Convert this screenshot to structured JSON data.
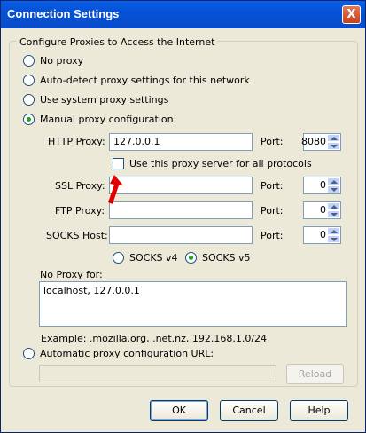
{
  "window": {
    "title": "Connection Settings",
    "close_label": "X"
  },
  "group": {
    "label": "Configure Proxies to Access the Internet"
  },
  "options": {
    "no_proxy": "No proxy",
    "auto_detect": "Auto-detect proxy settings for this network",
    "system": "Use system proxy settings",
    "manual": "Manual proxy configuration:",
    "auto_url": "Automatic proxy configuration URL:"
  },
  "http": {
    "label": "HTTP Proxy:",
    "value": "127.0.0.1",
    "port_label": "Port:",
    "port": "8080"
  },
  "use_all": {
    "label": "Use this proxy server for all protocols",
    "checked": false
  },
  "ssl": {
    "label": "SSL Proxy:",
    "value": "",
    "port_label": "Port:",
    "port": "0"
  },
  "ftp": {
    "label": "FTP Proxy:",
    "value": "",
    "port_label": "Port:",
    "port": "0"
  },
  "socks": {
    "label": "SOCKS Host:",
    "value": "",
    "port_label": "Port:",
    "port": "0",
    "v4": "SOCKS v4",
    "v5": "SOCKS v5"
  },
  "no_proxy_for": {
    "label": "No Proxy for:",
    "value": "localhost, 127.0.0.1",
    "example": "Example: .mozilla.org, .net.nz, 192.168.1.0/24"
  },
  "auto_url": {
    "value": "",
    "reload": "Reload"
  },
  "buttons": {
    "ok": "OK",
    "cancel": "Cancel",
    "help": "Help"
  },
  "colors": {
    "titlebar": "#0a5ee8",
    "annotation_arrow": "#e00000",
    "selected_radio": "#21a121"
  }
}
